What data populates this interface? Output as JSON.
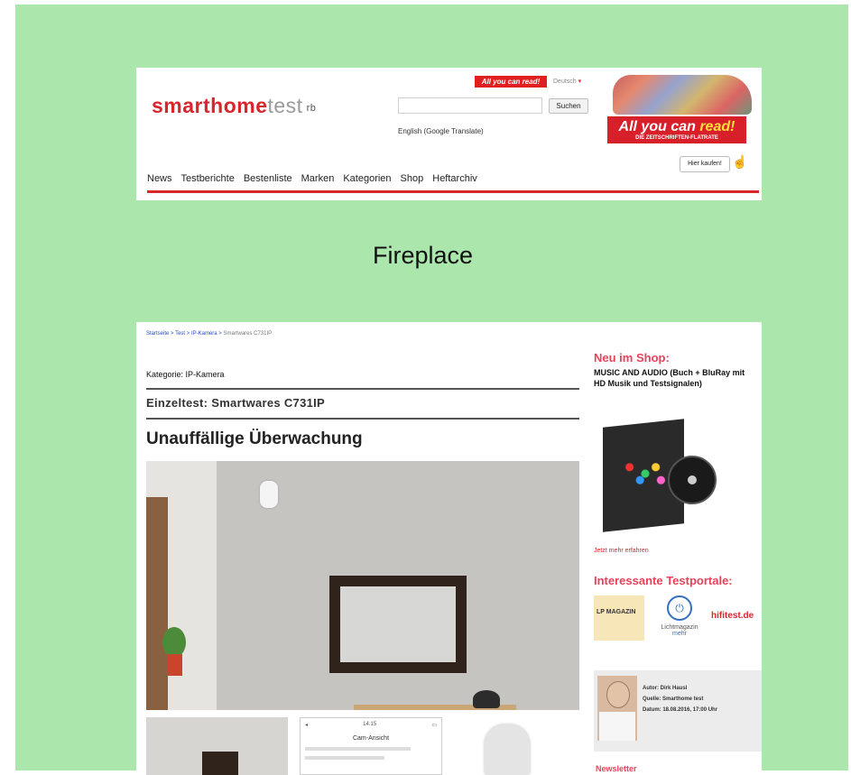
{
  "header": {
    "logo_main": "smarthome",
    "logo_light": "test",
    "logo_suffix": "rb",
    "ayc_small": "All you can read!",
    "language_select": "Deutsch",
    "search_button": "Suchen",
    "translate_link": "English (Google Translate)",
    "promo_title_white": "All you can ",
    "promo_title_yellow": "read!",
    "promo_subtitle": "DIE ZEITSCHRIFTEN-FLATRATE",
    "promo_buy": "Hier kaufen!",
    "nav": [
      "News",
      "Testberichte",
      "Bestenliste",
      "Marken",
      "Kategorien",
      "Shop",
      "Heftarchiv"
    ]
  },
  "caption": "Fireplace",
  "article": {
    "breadcrumb": [
      "Startseite",
      "Test",
      "IP-Kamera"
    ],
    "breadcrumb_current": "Smartwares C731IP",
    "category": "Kategorie: IP-Kamera",
    "einzeltest": "Einzeltest: Smartwares C731IP",
    "title": "Unauffällige Überwachung",
    "phone_time": "14:15",
    "phone_screen_title": "Cam-Ansicht"
  },
  "sidebar": {
    "neu_heading": "Neu im Shop:",
    "neu_text": "MUSIC AND AUDIO (Buch + BluRay mit HD Musik und Testsignalen)",
    "more_link": "Jetzt mehr erfahren",
    "testportale_heading": "Interessante Testportale:",
    "portal1": "LP MAGAZIN",
    "portal2": "Lichtmagazin",
    "portal2_link": "mehr",
    "portal3": "hifitest.de",
    "author_label": "Autor: Dirk Hausl",
    "author_source": "Quelle: Smarthome test",
    "author_date": "Datum: 18.08.2016, 17:00 Uhr",
    "newsletter": "Newsletter"
  }
}
